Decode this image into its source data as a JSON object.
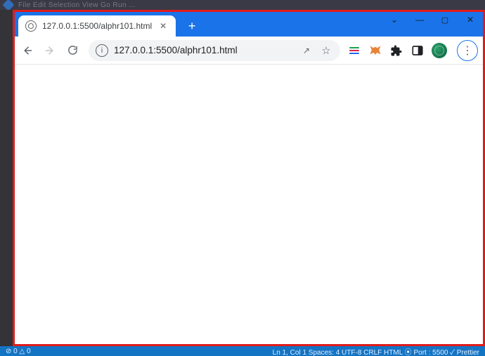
{
  "vscode": {
    "menu": "File  Edit  Selection  View  Go  Run  …",
    "status_left": "⊘ 0 △ 0",
    "status_right": "Ln 1, Col 1   Spaces: 4   UTF-8   CRLF   HTML   ⦿ Port : 5500   ✓ Prettier"
  },
  "chrome": {
    "tab_title": "127.0.0.1:5500/alphr101.html",
    "url": "127.0.0.1:5500/alphr101.html",
    "window_controls": {
      "dropdown": "⌄",
      "minimize": "—",
      "maximize": "▢",
      "close": "✕"
    },
    "new_tab": "+",
    "tab_close": "✕",
    "info_glyph": "i",
    "share_glyph": "↗",
    "star_glyph": "☆",
    "menu_glyph": "⋮"
  }
}
